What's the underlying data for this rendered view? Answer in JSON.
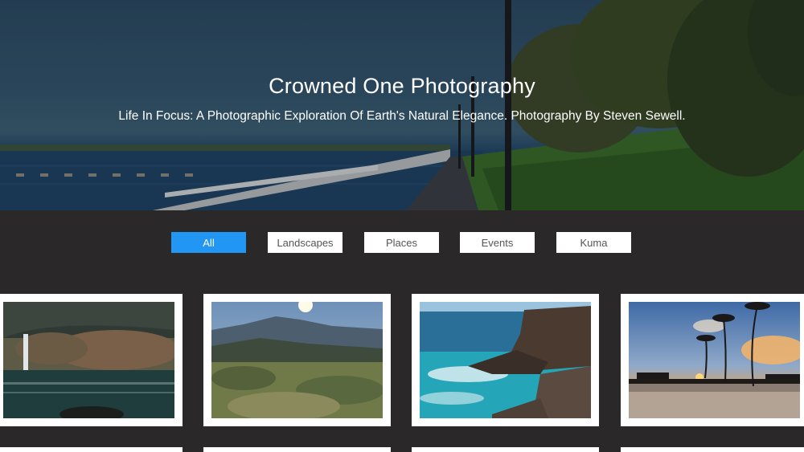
{
  "hero": {
    "title": "Crowned One Photography",
    "subtitle": "Life In Focus: A Photographic Exploration Of Earth's Natural Elegance. Photography By Steven Sewell."
  },
  "filters": {
    "active_color": "#2196f3",
    "items": [
      {
        "label": "All",
        "active": true
      },
      {
        "label": "Landscapes",
        "active": false
      },
      {
        "label": "Places",
        "active": false
      },
      {
        "label": "Events",
        "active": false
      },
      {
        "label": "Kuma",
        "active": false
      }
    ]
  },
  "gallery": {
    "photos": [
      {
        "subject": "cave waterfall lagoon"
      },
      {
        "subject": "mountain sunrise"
      },
      {
        "subject": "rocky coast"
      },
      {
        "subject": "beach palm sunset"
      }
    ]
  }
}
